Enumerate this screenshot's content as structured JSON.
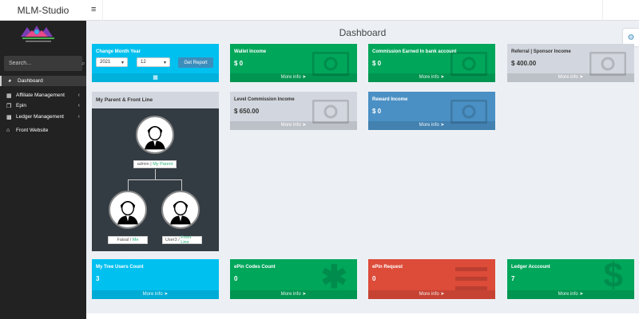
{
  "app": {
    "title": "MLM-Studio",
    "menu_icon": "≡"
  },
  "page_title": "Dashboard",
  "search": {
    "placeholder": "Search..."
  },
  "sidebar": {
    "items": [
      {
        "label": "Dashboard",
        "icon": "dashboard-icon",
        "active": true
      },
      {
        "label": "Affiliate Management",
        "icon": "users-icon",
        "has_chevron": true
      },
      {
        "label": "Epin",
        "icon": "copy-icon",
        "has_chevron": true
      },
      {
        "label": "Ledger Management",
        "icon": "ledger-icon",
        "has_chevron": true
      },
      {
        "label": "Front Website",
        "icon": "home-icon"
      }
    ]
  },
  "month_box": {
    "title": "Change Month Year",
    "year": "2021",
    "month": "12",
    "button": "Get Report"
  },
  "boxes": {
    "wallet": {
      "title": "Wallet Income",
      "value": "$ 0",
      "footer": "More info"
    },
    "commission": {
      "title": "Commission Earned In bank account",
      "value": "$ 0",
      "footer": "More info"
    },
    "referral": {
      "title": "Referral | Sponsor Income",
      "value": "$ 400.00",
      "footer": "More info"
    },
    "level": {
      "title": "Level Commission Income",
      "value": "$ 650.00",
      "footer": "More info"
    },
    "reward": {
      "title": "Reward Income",
      "value": "$ 0",
      "footer": "More info"
    },
    "tree_users": {
      "title": "My Tree Users Count",
      "value": "3",
      "footer": "More info"
    },
    "epin_codes": {
      "title": "ePin Codes Count",
      "value": "0",
      "footer": "More info"
    },
    "epin_request": {
      "title": "ePin Request",
      "value": "0",
      "footer": "More info"
    },
    "ledger": {
      "title": "Ledger Acccount",
      "value": "7",
      "footer": "More info"
    }
  },
  "parent_panel": {
    "title": "My Parent & Front Line",
    "parent": {
      "name": "admin",
      "role": "My Parent"
    },
    "children": [
      {
        "name": "Faisal",
        "role": "Me"
      },
      {
        "name": "User3",
        "role": "Front Line"
      }
    ]
  },
  "colors": {
    "aqua": "#00c0ef",
    "green": "#00a65a",
    "gray": "#d2d6de",
    "blue": "#4a90c4",
    "red": "#dd4b39",
    "sidebar": "#222222"
  }
}
